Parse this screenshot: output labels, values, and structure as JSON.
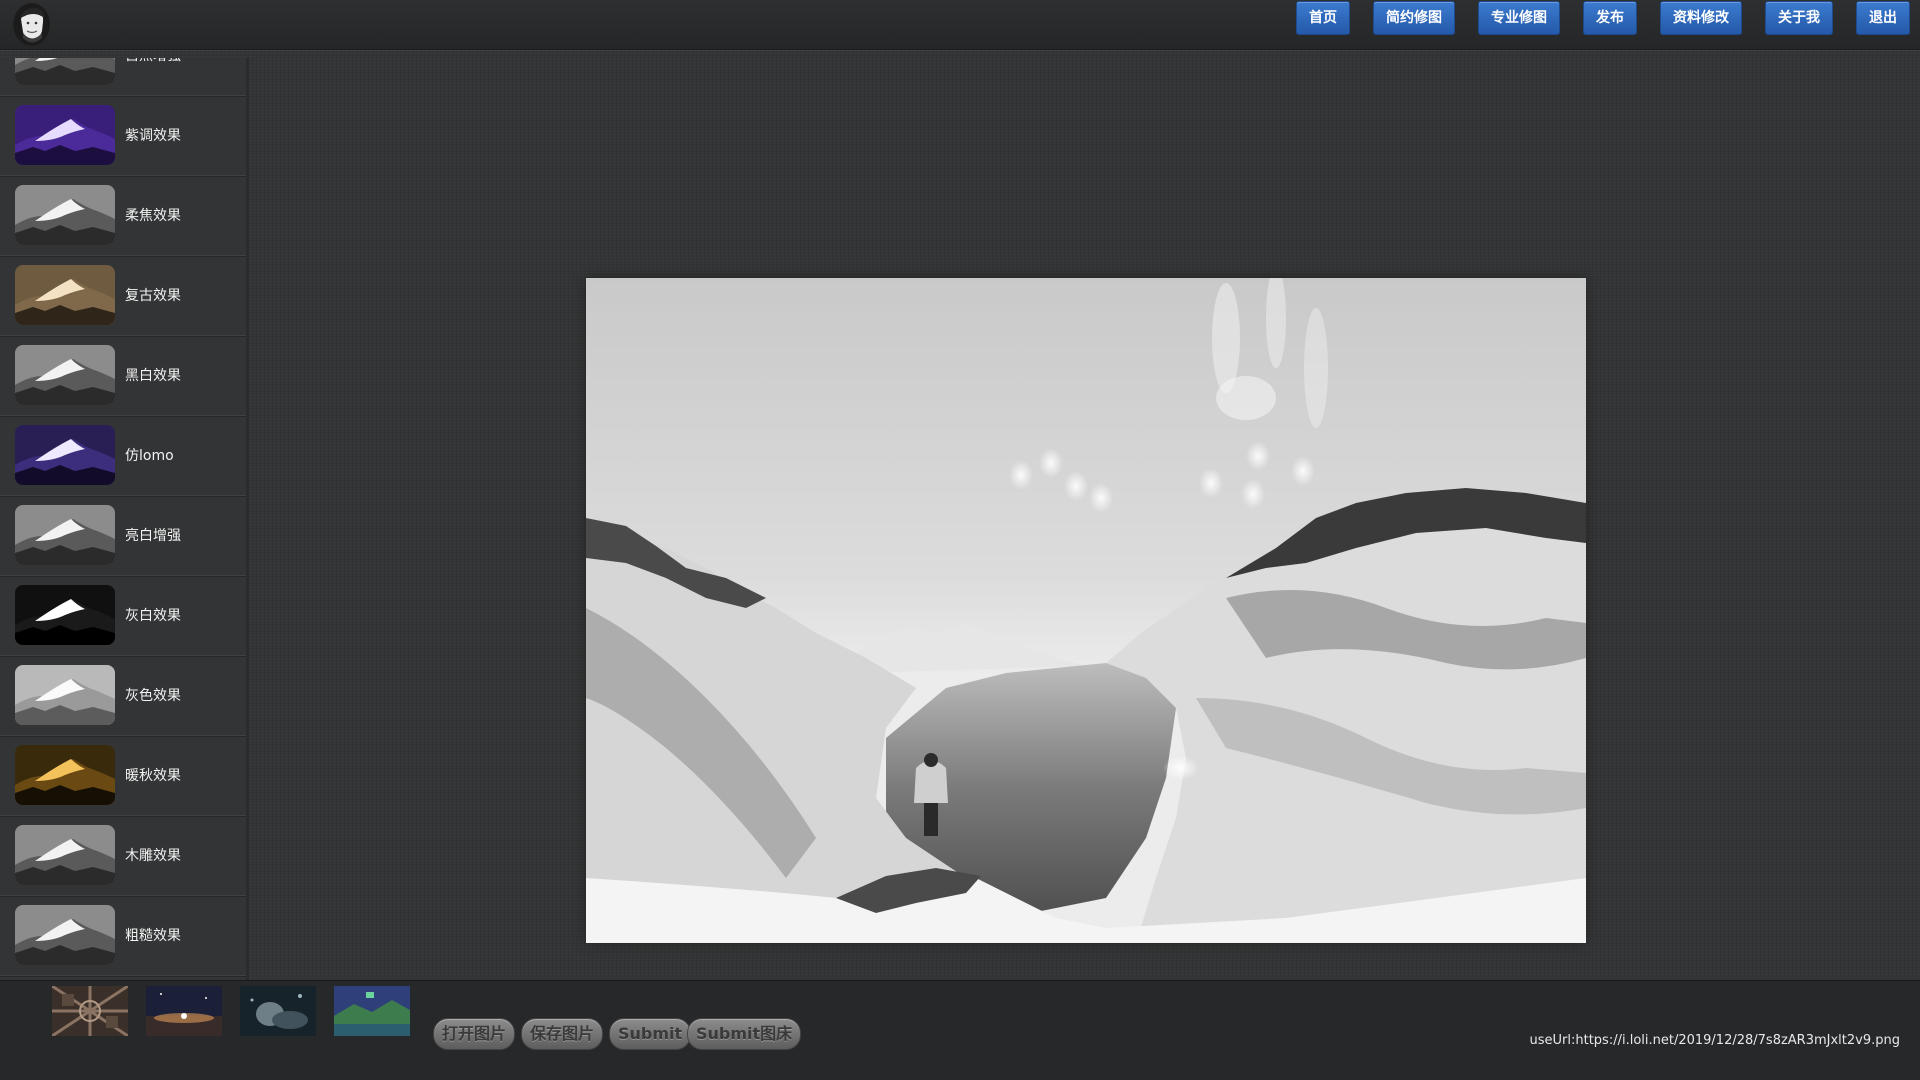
{
  "nav": {
    "items": [
      {
        "label": "首页"
      },
      {
        "label": "简约修图"
      },
      {
        "label": "专业修图"
      },
      {
        "label": "发布"
      },
      {
        "label": "资料修改"
      },
      {
        "label": "关于我"
      },
      {
        "label": "退出"
      }
    ],
    "accent": "#2d67bd"
  },
  "sidebar": {
    "effects": [
      {
        "label": "自然增强",
        "tone": "gray"
      },
      {
        "label": "紫调效果",
        "tone": "purple"
      },
      {
        "label": "柔焦效果",
        "tone": "gray"
      },
      {
        "label": "复古效果",
        "tone": "sepia"
      },
      {
        "label": "黑白效果",
        "tone": "gray"
      },
      {
        "label": "仿lomo",
        "tone": "lomo"
      },
      {
        "label": "亮白增强",
        "tone": "gray"
      },
      {
        "label": "灰白效果",
        "tone": "contrast"
      },
      {
        "label": "灰色效果",
        "tone": "light"
      },
      {
        "label": "暖秋效果",
        "tone": "gold"
      },
      {
        "label": "木雕效果",
        "tone": "gray"
      },
      {
        "label": "粗糙效果",
        "tone": "gray"
      }
    ]
  },
  "history": {
    "thumbs": [
      {
        "icon": "pattern-thumbnail"
      },
      {
        "icon": "night-sky-thumbnail"
      },
      {
        "icon": "portrait-thumbnail"
      },
      {
        "icon": "landscape-thumbnail"
      }
    ]
  },
  "toolbar": {
    "open_label": "打开图片",
    "save_label": "保存图片",
    "submit_label": "Submit",
    "submit_bed_label": "Submit图床"
  },
  "status": {
    "use_url": "useUrl:https://i.loli.net/2019/12/28/7s8zAR3mJxlt2v9.png"
  }
}
